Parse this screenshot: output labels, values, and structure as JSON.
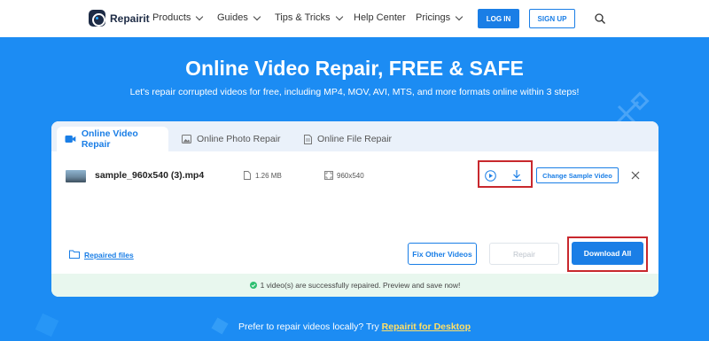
{
  "nav": {
    "brand": "Repairit",
    "items": [
      {
        "label": "Products"
      },
      {
        "label": "Guides"
      },
      {
        "label": "Tips & Tricks"
      },
      {
        "label": "Help Center"
      },
      {
        "label": "Pricings"
      }
    ],
    "login_label": "LOG IN",
    "signup_label": "SIGN UP"
  },
  "hero": {
    "title": "Online Video Repair, FREE & SAFE",
    "subtitle": "Let's repair corrupted videos for free, including MP4, MOV, AVI, MTS, and more formats online within 3 steps!"
  },
  "tabs": [
    {
      "label": "Online Video Repair",
      "active": true,
      "icon": "video-icon"
    },
    {
      "label": "Online Photo Repair",
      "active": false,
      "icon": "photo-icon"
    },
    {
      "label": "Online File Repair",
      "active": false,
      "icon": "file-icon"
    }
  ],
  "file": {
    "name": "sample_960x540 (3).mp4",
    "size": "1.26 MB",
    "resolution": "960x540",
    "change_sample_label": "Change Sample Video"
  },
  "actions": {
    "repaired_files_label": "Repaired files",
    "fix_other_label": "Fix Other Videos",
    "repair_label": "Repair",
    "download_all_label": "Download All"
  },
  "status": {
    "message": "1 video(s) are successfully repaired. Preview and save now!"
  },
  "footer": {
    "prompt": "Prefer to repair videos locally? Try ",
    "link_label": "Repairit for Desktop"
  },
  "colors": {
    "accent": "#1a7ee6",
    "hero_bg": "#1c8cf3",
    "highlight": "#c8282d",
    "success": "#2fbf71"
  }
}
